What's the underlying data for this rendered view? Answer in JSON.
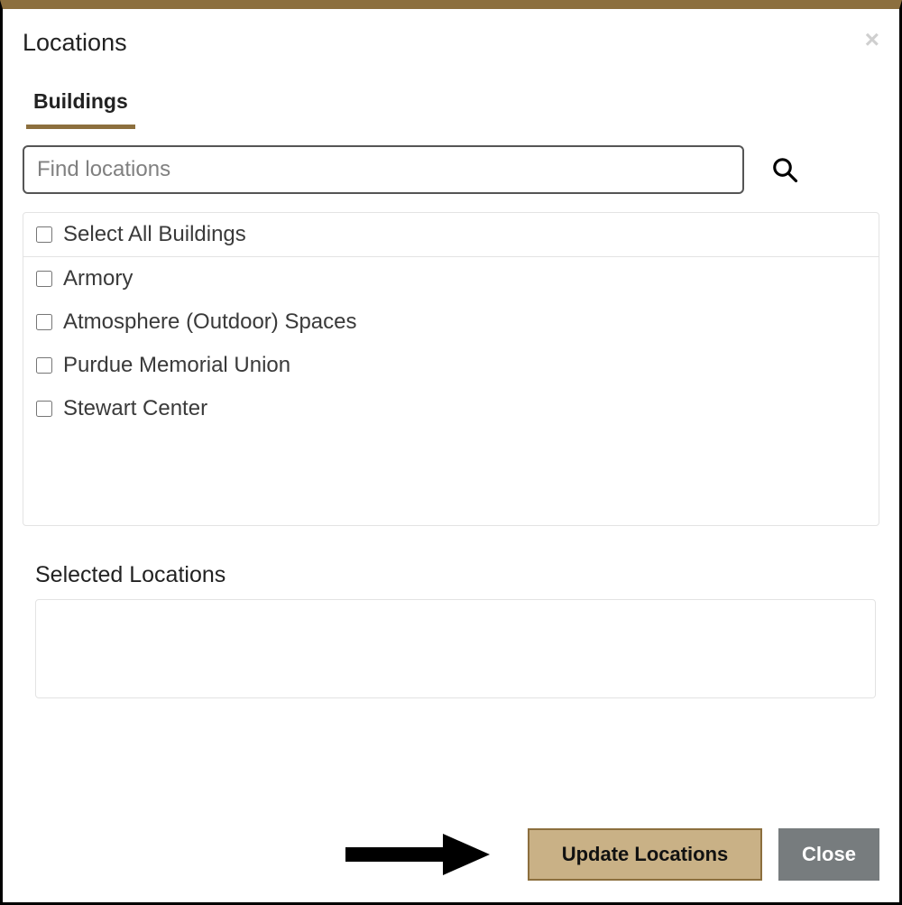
{
  "modal": {
    "title": "Locations",
    "close_glyph": "×"
  },
  "tabs": {
    "active_label": "Buildings"
  },
  "search": {
    "placeholder": "Find locations",
    "value": ""
  },
  "list": {
    "select_all_label": "Select All Buildings",
    "items": [
      {
        "label": "Armory",
        "checked": false
      },
      {
        "label": "Atmosphere (Outdoor) Spaces",
        "checked": false
      },
      {
        "label": "Purdue Memorial Union",
        "checked": false
      },
      {
        "label": "Stewart Center",
        "checked": false
      }
    ]
  },
  "selected": {
    "heading": "Selected Locations"
  },
  "footer": {
    "update_label": "Update Locations",
    "close_label": "Close"
  }
}
